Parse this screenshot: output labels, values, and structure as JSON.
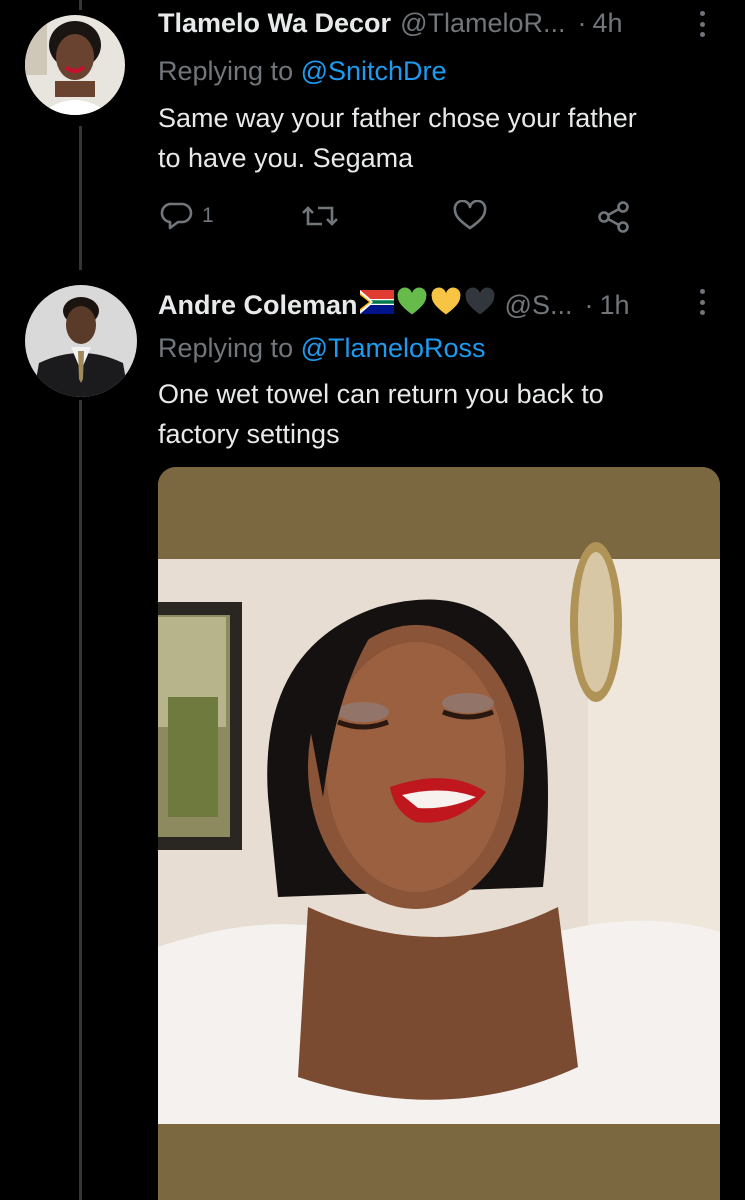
{
  "tweets": [
    {
      "display_name": "Tlamelo Wa Decor",
      "handle": "@TlameloR...",
      "separator": "·",
      "time": "4h",
      "replying_label": "Replying to ",
      "replying_to": "@SnitchDre",
      "text_line1": "Same way your father chose your father",
      "text_line2": "to have you. Segama",
      "reply_count": "1"
    },
    {
      "display_name": "Andre Coleman",
      "handle": "@S...",
      "separator": "·",
      "time": "1h",
      "replying_label": "Replying to ",
      "replying_to": "@TlameloRoss",
      "text_line1": "One wet towel can return you back to",
      "text_line2": "factory settings",
      "name_emojis": [
        "south-africa-flag",
        "green-heart",
        "yellow-heart",
        "black-heart"
      ]
    }
  ],
  "colors": {
    "background": "#000000",
    "text": "#e7e9ea",
    "muted": "#71767b",
    "link": "#1d9bf0",
    "thread_line": "#333639",
    "media_band": "#7b6840"
  }
}
